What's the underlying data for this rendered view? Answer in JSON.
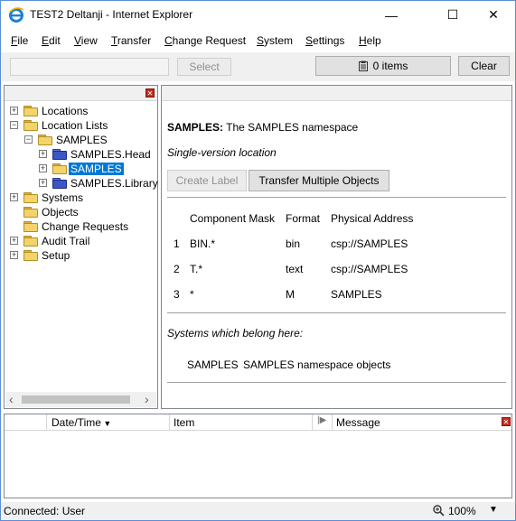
{
  "window": {
    "title": "TEST2 Deltanji - Internet Explorer",
    "controls": {
      "minimize": "—",
      "maximize": "☐",
      "close": "✕"
    }
  },
  "menu": {
    "items": [
      {
        "label": "File",
        "key": "F",
        "rest": "ile"
      },
      {
        "label": "Edit",
        "key": "E",
        "rest": "dit"
      },
      {
        "label": "View",
        "key": "V",
        "rest": "iew"
      },
      {
        "label": "Transfer",
        "key": "T",
        "rest": "ransfer"
      },
      {
        "label": "Change Request",
        "key": "C",
        "rest": "hange Request"
      },
      {
        "label": "System",
        "key": "S",
        "rest": "ystem"
      },
      {
        "label": "Settings",
        "key": "S",
        "rest": "ettings"
      },
      {
        "label": "Help",
        "key": "H",
        "rest": "elp"
      }
    ]
  },
  "toolbar": {
    "search_value": "",
    "select_label": "Select",
    "items_label": "0 items",
    "clear_label": "Clear"
  },
  "tree": {
    "items": [
      {
        "label": "Locations",
        "expander": "+",
        "folder": "yellow"
      },
      {
        "label": "Location Lists",
        "expander": "−",
        "folder": "yellow"
      },
      {
        "label": "SAMPLES",
        "expander": "−",
        "folder": "yellow"
      },
      {
        "label": "SAMPLES.Head",
        "expander": "+",
        "folder": "blue"
      },
      {
        "label": "SAMPLES",
        "expander": "+",
        "folder": "yellow",
        "selected": true
      },
      {
        "label": "SAMPLES.Library",
        "expander": "+",
        "folder": "blue"
      },
      {
        "label": "Systems",
        "expander": "+",
        "folder": "yellow"
      },
      {
        "label": "Objects",
        "expander": "",
        "folder": "yellow"
      },
      {
        "label": "Change Requests",
        "expander": "",
        "folder": "yellow"
      },
      {
        "label": "Audit Trail",
        "expander": "+",
        "folder": "yellow"
      },
      {
        "label": "Setup",
        "expander": "+",
        "folder": "yellow"
      }
    ]
  },
  "detail": {
    "name": "SAMPLES:",
    "description": "The SAMPLES namespace",
    "location_type": "Single-version location",
    "create_label_button": "Create Label",
    "transfer_button": "Transfer Multiple Objects",
    "table": {
      "headers": [
        "Component Mask",
        "Format",
        "Physical Address"
      ],
      "rows": [
        {
          "num": "1",
          "mask": "BIN.*",
          "format": "bin",
          "address": "csp://SAMPLES"
        },
        {
          "num": "2",
          "mask": "T.*",
          "format": "text",
          "address": "csp://SAMPLES"
        },
        {
          "num": "3",
          "mask": "*",
          "format": "M",
          "address": "SAMPLES"
        }
      ]
    },
    "systems_heading": "Systems which belong here:",
    "systems": [
      {
        "name": "SAMPLES",
        "description": "SAMPLES namespace objects"
      }
    ]
  },
  "log": {
    "columns": {
      "datetime": "Date/Time",
      "item": "Item",
      "message": "Message"
    }
  },
  "status": {
    "text": "Connected: User",
    "zoom": "100%"
  }
}
